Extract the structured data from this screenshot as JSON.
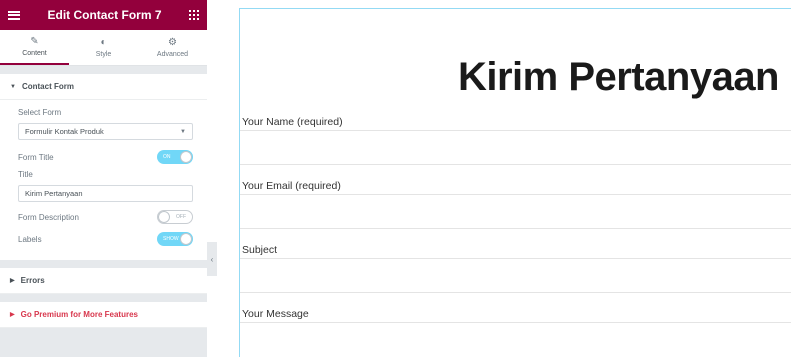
{
  "header": {
    "title": "Edit Contact Form 7"
  },
  "tabs": [
    {
      "label": "Content",
      "icon": "pencil-icon"
    },
    {
      "label": "Style",
      "icon": "half-circle-icon"
    },
    {
      "label": "Advanced",
      "icon": "gear-icon"
    }
  ],
  "contact_form": {
    "section_title": "Contact Form",
    "select_form_label": "Select Form",
    "select_form_value": "Formulir Kontak Produk",
    "form_title_label": "Form Title",
    "form_title_toggle": "ON",
    "title_label": "Title",
    "title_value": "Kirim Pertanyaan",
    "form_description_label": "Form Description",
    "form_description_toggle": "OFF",
    "labels_label": "Labels",
    "labels_toggle": "SHOW"
  },
  "errors": {
    "section_title": "Errors"
  },
  "premium": {
    "section_title": "Go Premium for More Features"
  },
  "preview": {
    "heading": "Kirim Pertanyaan",
    "fields": [
      "Your Name (required)",
      "Your Email (required)",
      "Subject",
      "Your Message"
    ]
  },
  "colors": {
    "brand": "#93003c",
    "toggle_on": "#71d7f7",
    "premium": "#d8374d",
    "preview_border": "#93daf4"
  }
}
